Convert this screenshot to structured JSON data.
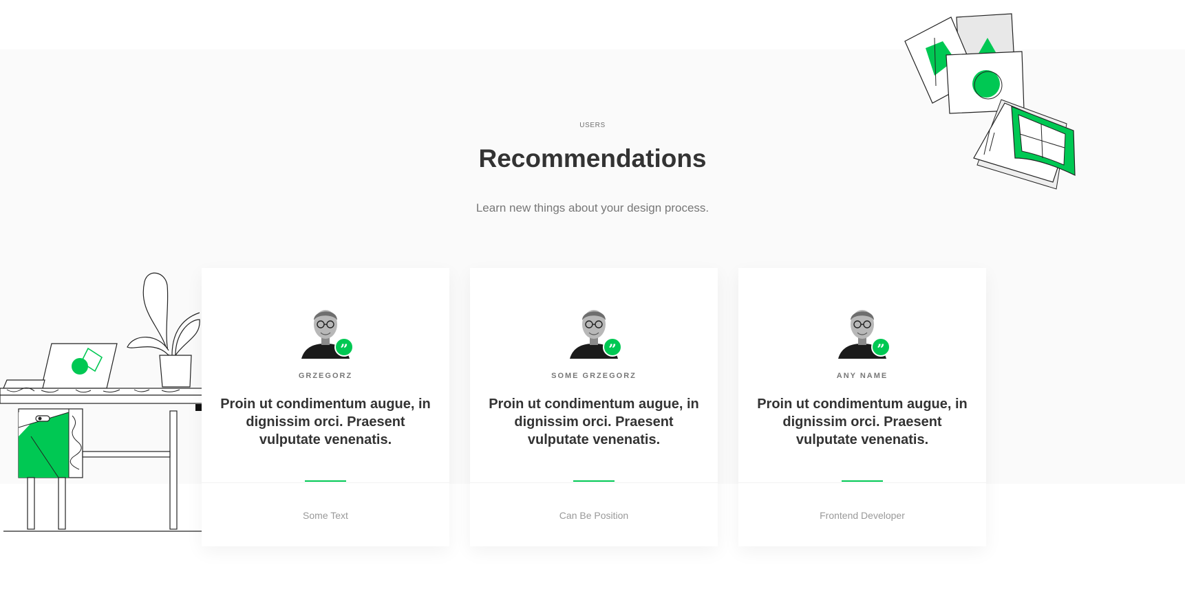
{
  "section": {
    "eyebrow": "USERS",
    "title": "Recommendations",
    "subtitle": "Learn new things about your design process."
  },
  "colors": {
    "accent": "#00c853",
    "section_bg": "#fafafa",
    "title": "#333333",
    "muted": "#999999"
  },
  "cards": [
    {
      "name": "GRZEGORZ",
      "quote": "Proin ut condimentum augue, in dignissim orci. Praesent vulputate venenatis.",
      "position": "Some Text",
      "avatar_icon": "person-avatar",
      "badge_icon": "quote-icon",
      "badge_glyph": "”"
    },
    {
      "name": "SOME GRZEGORZ",
      "quote": "Proin ut condimentum augue, in dignissim orci. Praesent vulputate venenatis.",
      "position": "Can Be Position",
      "avatar_icon": "person-avatar",
      "badge_icon": "quote-icon",
      "badge_glyph": "”"
    },
    {
      "name": "ANY NAME",
      "quote": "Proin ut condimentum augue, in dignissim orci. Praesent vulputate venenatis.",
      "position": "Frontend Developer",
      "avatar_icon": "person-avatar",
      "badge_icon": "quote-icon",
      "badge_glyph": "”"
    }
  ],
  "illustrations": {
    "top_right": "design-cards-illustration",
    "left": "desk-laptop-plant-illustration"
  }
}
